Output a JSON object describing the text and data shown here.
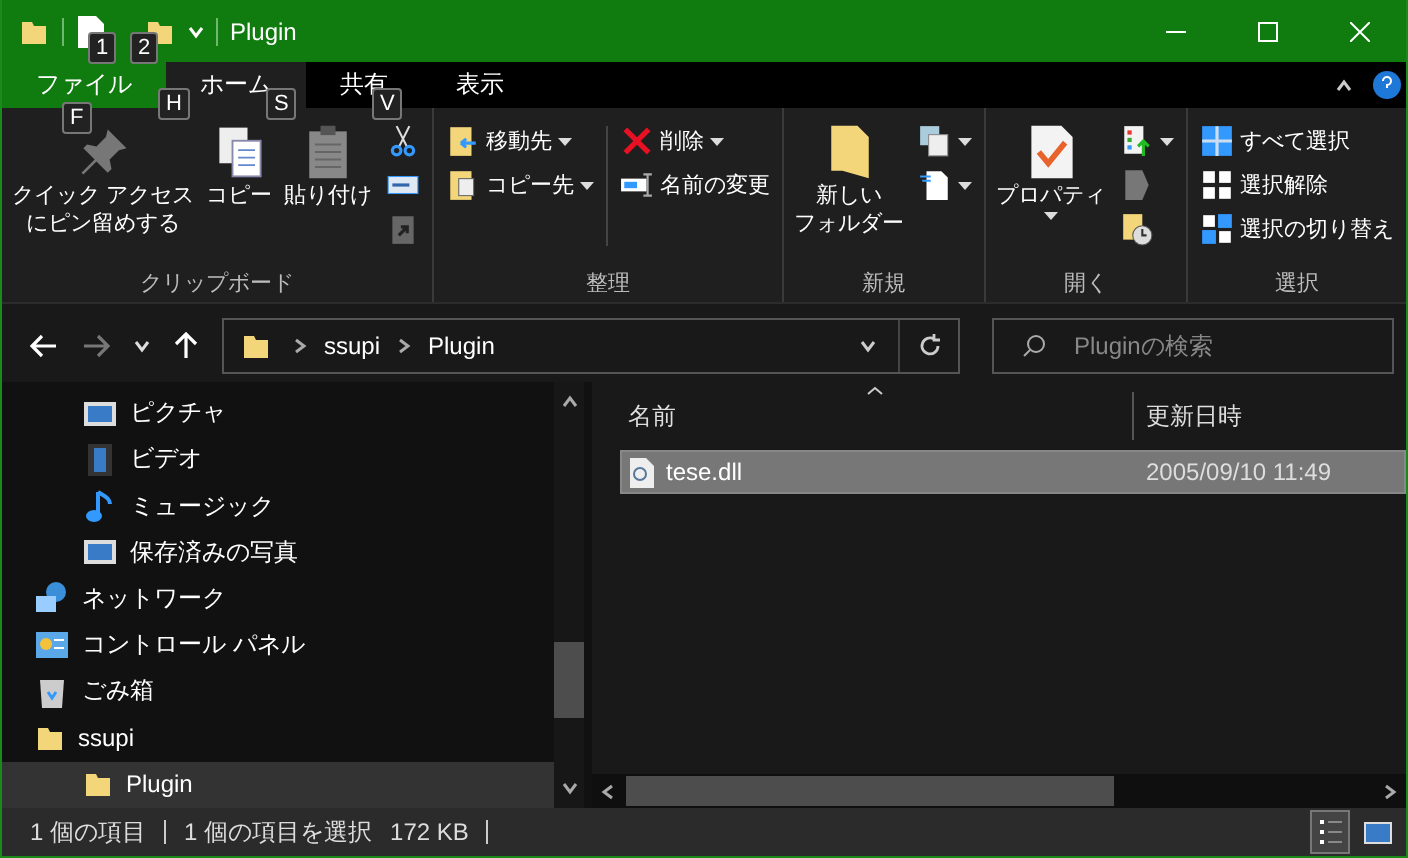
{
  "window": {
    "title": "Plugin"
  },
  "quick_access": {
    "keytips": [
      "1",
      "2"
    ]
  },
  "ribbon_tabs": [
    {
      "label": "ファイル",
      "kind": "file",
      "selected": false,
      "keytip": "F"
    },
    {
      "label": "ホーム",
      "kind": "tab",
      "selected": true,
      "keytip": "H"
    },
    {
      "label": "共有",
      "kind": "tab",
      "selected": false,
      "keytip": "S"
    },
    {
      "label": "表示",
      "kind": "tab",
      "selected": false,
      "keytip": "V"
    }
  ],
  "ribbon_groups": [
    {
      "label": "クリップボード",
      "items": [
        {
          "kind": "large",
          "lines": [
            "クイック アクセス",
            "にピン留めする"
          ],
          "dropdown": false
        },
        {
          "kind": "large",
          "lines": [
            "コピー"
          ],
          "dropdown": false
        },
        {
          "kind": "large",
          "lines": [
            "貼り付け"
          ],
          "dropdown": false
        },
        {
          "kind": "stack",
          "items": [
            {
              "kind": "icon",
              "dropdown": false
            },
            {
              "kind": "icon",
              "dropdown": false
            },
            {
              "kind": "icon",
              "dropdown": false
            }
          ]
        }
      ]
    },
    {
      "label": "整理",
      "items": [
        {
          "kind": "stack",
          "items": [
            {
              "kind": "small",
              "label": "移動先",
              "dropdown": true
            },
            {
              "kind": "small",
              "label": "コピー先",
              "dropdown": true
            }
          ]
        },
        {
          "kind": "divider"
        },
        {
          "kind": "stack",
          "items": [
            {
              "kind": "small",
              "label": "削除",
              "dropdown": true
            },
            {
              "kind": "small",
              "label": "名前の変更",
              "dropdown": false
            }
          ]
        }
      ]
    },
    {
      "label": "新規",
      "items": [
        {
          "kind": "large",
          "lines": [
            "新しい",
            "フォルダー"
          ],
          "dropdown": false
        },
        {
          "kind": "stack",
          "items": [
            {
              "kind": "icon",
              "dropdown": true
            },
            {
              "kind": "icon",
              "dropdown": true
            }
          ]
        }
      ]
    },
    {
      "label": "開く",
      "items": [
        {
          "kind": "large",
          "lines": [
            "プロパティ"
          ],
          "dropdown": true
        },
        {
          "kind": "stack",
          "items": [
            {
              "kind": "icon",
              "dropdown": true
            },
            {
              "kind": "icon",
              "dropdown": false
            },
            {
              "kind": "icon",
              "dropdown": false
            }
          ]
        }
      ]
    },
    {
      "label": "選択",
      "items": [
        {
          "kind": "stack",
          "items": [
            {
              "kind": "small",
              "label": "すべて選択",
              "dropdown": false
            },
            {
              "kind": "small",
              "label": "選択解除",
              "dropdown": false
            },
            {
              "kind": "small",
              "label": "選択の切り替え",
              "dropdown": false
            }
          ]
        }
      ]
    }
  ],
  "address": {
    "breadcrumbs": [
      "ssupi",
      "Plugin"
    ],
    "forward_disabled": true
  },
  "search": {
    "placeholder": "Pluginの検索"
  },
  "nav": {
    "tree": [
      {
        "children": [
          {
            "label": "ピクチャ",
            "kind": "images",
            "selected": false
          },
          {
            "label": "ビデオ",
            "kind": "video",
            "selected": false
          },
          {
            "label": "ミュージック",
            "kind": "music",
            "selected": false
          },
          {
            "label": "保存済みの写真",
            "kind": "images",
            "selected": false
          }
        ]
      },
      {
        "label": "ネットワーク",
        "kind": "network",
        "selected": false
      },
      {
        "label": "コントロール パネル",
        "kind": "control",
        "selected": false
      },
      {
        "label": "ごみ箱",
        "kind": "trash",
        "selected": false
      },
      {
        "label": "ssupi",
        "kind": "folder",
        "selected": false,
        "children": [
          {
            "label": "Plugin",
            "kind": "folder",
            "selected": true
          }
        ]
      }
    ]
  },
  "file_list": {
    "columns": [
      "名前",
      "更新日時"
    ],
    "rows": [
      {
        "name": "tese.dll",
        "modified": "2005/09/10 11:49",
        "selected": true
      }
    ]
  },
  "status_bar": {
    "items": [
      "1 個の項目",
      "1 個の項目を選択",
      "172 KB"
    ],
    "view_buttons": [
      {
        "kind": "details",
        "selected": true
      },
      {
        "kind": "tiles",
        "selected": false
      }
    ]
  }
}
